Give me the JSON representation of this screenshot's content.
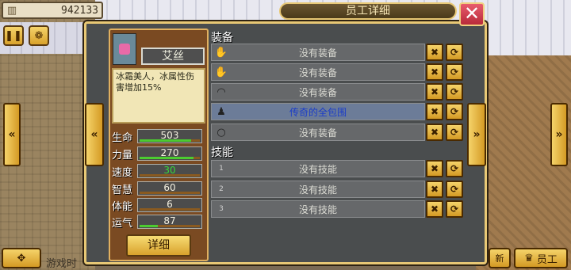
{
  "hud": {
    "coins": "942133",
    "coin_icon": "building-icon",
    "menu_icon": "pause-icon",
    "settings_icon": "gear-icon",
    "move_icon": "move-icon",
    "ghost_label": "游戏时",
    "new_label": "新",
    "staff_label": "员工"
  },
  "dialog": {
    "title": "员工详细",
    "close_label": "✕"
  },
  "profile": {
    "name": "艾丝",
    "description": "冰霜美人，冰属性伤害增加15%",
    "detail_label": "详细",
    "stats": [
      {
        "label": "生命",
        "value": "503",
        "fill": 0.85,
        "green": false
      },
      {
        "label": "力量",
        "value": "270",
        "fill": 0.9,
        "green": false
      },
      {
        "label": "速度",
        "value": "30",
        "fill": 0.0,
        "green": true
      },
      {
        "label": "智慧",
        "value": "60",
        "fill": 0.0,
        "green": false
      },
      {
        "label": "体能",
        "value": "6",
        "fill": 0.0,
        "green": false
      },
      {
        "label": "运气",
        "value": "87",
        "fill": 0.3,
        "green": false
      }
    ]
  },
  "equipment": {
    "title": "装备",
    "slots": [
      {
        "icon": "glove-icon",
        "text": "没有装备"
      },
      {
        "icon": "glove-icon",
        "text": "没有装备"
      },
      {
        "icon": "helmet-icon",
        "text": "没有装备"
      },
      {
        "icon": "cloak-icon",
        "text": "传奇的全包围"
      },
      {
        "icon": "ring-icon",
        "text": "没有装备"
      }
    ]
  },
  "skills": {
    "title": "技能",
    "slots": [
      {
        "index": "1",
        "text": "没有技能"
      },
      {
        "index": "2",
        "text": "没有技能"
      },
      {
        "index": "3",
        "text": "没有技能"
      }
    ]
  },
  "colors": {
    "accent": "#e8c875",
    "highlight_text": "#1a3cc8",
    "stat_green": "#3ad63a"
  }
}
